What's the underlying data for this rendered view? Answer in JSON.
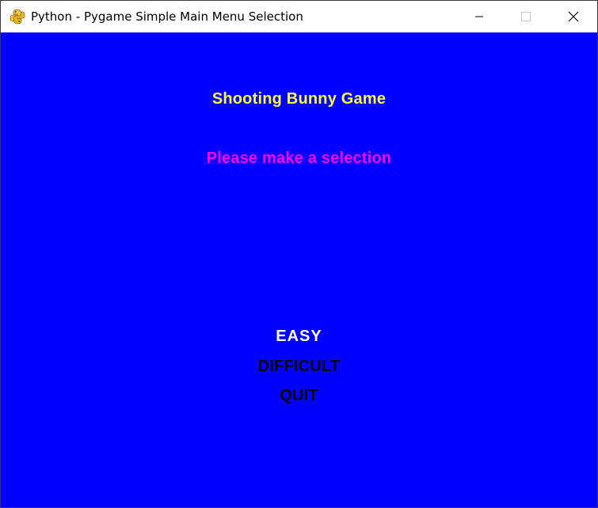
{
  "window": {
    "title": "Python - Pygame Simple Main Menu Selection",
    "icon": "pygame-snake-icon",
    "controls": {
      "minimize_icon": "minimize-icon",
      "maximize_icon": "maximize-icon",
      "close_icon": "close-icon"
    }
  },
  "game": {
    "background_color": "#0000fe",
    "title": "Shooting Bunny Game",
    "title_color": "#fdfd3f",
    "subtitle": "Please make a selection",
    "subtitle_color": "#ff00ff",
    "menu": {
      "items": [
        {
          "label": "EASY",
          "color": "#ffffff",
          "selected": true
        },
        {
          "label": "DIFFICULT",
          "color": "#000000",
          "selected": false
        },
        {
          "label": "QUIT",
          "color": "#000000",
          "selected": false
        }
      ]
    }
  }
}
